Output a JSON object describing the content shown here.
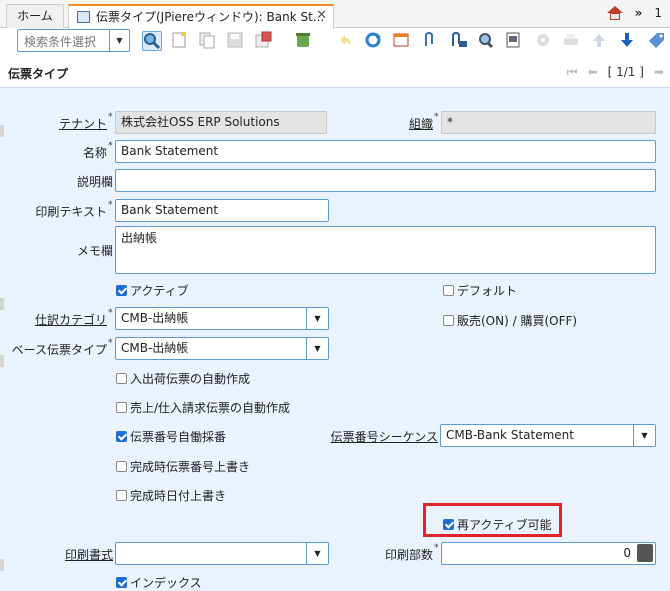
{
  "tabs": {
    "home_label": "ホーム",
    "active_label": "伝票タイプ(JPiereウィンドウ): Bank St...",
    "close_glyph": "✕"
  },
  "topbar": {
    "count": "1"
  },
  "toolbar": {
    "search_placeholder": "検索条件選択"
  },
  "header": {
    "title": "伝票タイプ",
    "record": "[ 1/1 ]"
  },
  "form": {
    "tenant_label": "テナント",
    "tenant_value": "株式会社OSS ERP Solutions",
    "org_label": "組織",
    "org_value": "*",
    "name_label": "名称",
    "name_value": "Bank Statement",
    "description_label": "説明欄",
    "description_value": "",
    "print_text_label": "印刷テキスト",
    "print_text_value": "Bank Statement",
    "memo_label": "メモ欄",
    "memo_value": "出納帳",
    "active_label": "アクティブ",
    "default_label": "デフォルト",
    "gl_category_label": "仕訳カテゴリ",
    "gl_category_value": "CMB-出納帳",
    "sales_purchase_label": "販売(ON) / 購買(OFF)",
    "base_doc_type_label": "ベース伝票タイプ",
    "base_doc_type_value": "CMB-出納帳",
    "auto_shipment_label": "入出荷伝票の自動作成",
    "auto_invoice_label": "売上/仕入請求伝票の自動作成",
    "auto_doc_no_label": "伝票番号自働採番",
    "doc_seq_label": "伝票番号シーケンス",
    "doc_seq_value": "CMB-Bank Statement",
    "overwrite_docno_label": "完成時伝票番号上書き",
    "overwrite_date_label": "完成時日付上書き",
    "reactivate_label": "再アクティブ可能",
    "print_format_label": "印刷書式",
    "print_format_value": "",
    "copies_label": "印刷部数",
    "copies_value": "0",
    "index_label": "インデックス"
  }
}
